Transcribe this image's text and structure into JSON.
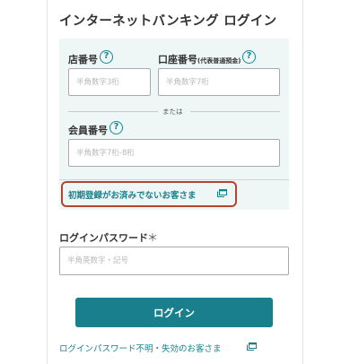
{
  "page": {
    "title": "インターネットバンキング ログイン"
  },
  "branch": {
    "label": "店番号",
    "help": "?",
    "placeholder": "半角数字3桁",
    "value": ""
  },
  "account": {
    "label": "口座番号",
    "label_note": "(代表普通預金)",
    "help": "?",
    "placeholder": "半角数字7桁",
    "value": ""
  },
  "separator": {
    "text": "または"
  },
  "member": {
    "label": "会員番号",
    "help": "?",
    "placeholder": "半角数字7桁-8桁",
    "value": ""
  },
  "first_time": {
    "link_text": "初期登録がお済みでないお客さま",
    "icon": "external-window-icon"
  },
  "password": {
    "label": "ログインパスワード",
    "required_mark": "＊",
    "placeholder": "半角英数字・記号",
    "value": ""
  },
  "login_button": {
    "label": "ログイン"
  },
  "forgot": {
    "link_text": "ログインパスワード不明・失効のお客さま",
    "icon": "external-window-icon"
  },
  "colors": {
    "accent": "#1a7f8c",
    "panel_bg": "#eef6f6",
    "highlight_border": "#b44431"
  }
}
